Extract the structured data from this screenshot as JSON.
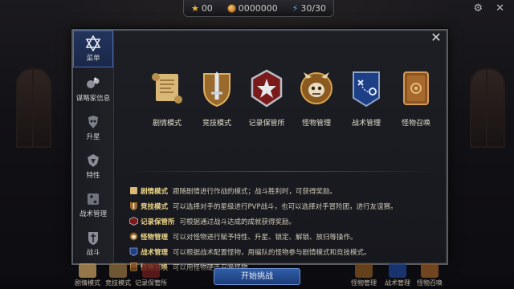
{
  "topbar": {
    "stars": "00",
    "coins": "0000000",
    "energy": "30/30"
  },
  "panel": {
    "close_label": "✕"
  },
  "sidenav": [
    {
      "label": "菜单",
      "icon": "hexagram-icon",
      "active": true
    },
    {
      "label": "谋略家信息",
      "icon": "strategist-info-icon",
      "active": false
    },
    {
      "label": "升星",
      "icon": "star-up-icon",
      "active": false
    },
    {
      "label": "特性",
      "icon": "trait-icon",
      "active": false
    },
    {
      "label": "战术管理",
      "icon": "tactics-icon",
      "active": false
    },
    {
      "label": "战斗",
      "icon": "battle-icon",
      "active": false
    }
  ],
  "modes": [
    {
      "label": "剧情模式",
      "icon": "scroll-icon"
    },
    {
      "label": "竞技模式",
      "icon": "sword-shield-icon"
    },
    {
      "label": "记录保管所",
      "icon": "star-badge-icon"
    },
    {
      "label": "怪物管理",
      "icon": "monster-skull-icon"
    },
    {
      "label": "战术管理",
      "icon": "tactics-banner-icon"
    },
    {
      "label": "怪物召唤",
      "icon": "summon-book-icon"
    }
  ],
  "descriptions": [
    {
      "name": "剧情模式",
      "text": "跟随剧情进行作战的模式；战斗胜利时，可获得奖励。"
    },
    {
      "name": "竞技模式",
      "text": "可以选择对手的星级进行PVP战斗，也可以选择对手冒险团，进行友谊赛。"
    },
    {
      "name": "记录保管所",
      "text": "可根据通过战斗达成的成就获得奖励。"
    },
    {
      "name": "怪物管理",
      "text": "可以对怪物进行赋予特性、升星、锁定、解锁、放归等操作。"
    },
    {
      "name": "战术管理",
      "text": "可以根据战术配置怪物，用编队的怪物参与剧情模式和竞技模式。"
    },
    {
      "name": "怪物召唤",
      "text": "可以用怪物硬币召唤怪物。"
    }
  ],
  "bottombar": {
    "start_label": "开始挑战",
    "items": [
      "剧情模式",
      "竞技模式",
      "记录保管所",
      "怪物管理",
      "战术管理",
      "怪物召唤"
    ]
  },
  "colors": {
    "accent": "#2f5ea8",
    "highlight_text": "#f1d98a",
    "panel_bg": "#1b1c22"
  }
}
